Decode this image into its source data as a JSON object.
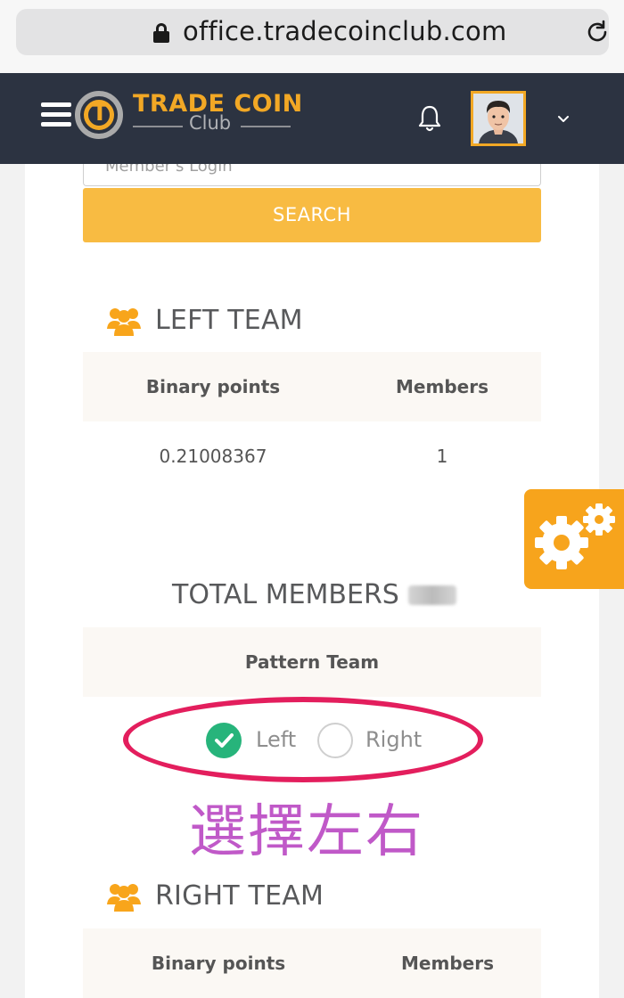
{
  "browser": {
    "url": "office.tradecoinclub.com"
  },
  "header": {
    "brand_main": "TRADE COIN",
    "brand_sub": "Club",
    "logo_letter": "T"
  },
  "search": {
    "placeholder": "Member's Login",
    "button_label": "SEARCH"
  },
  "left_team": {
    "title": "LEFT TEAM",
    "columns": [
      "Binary points",
      "Members"
    ],
    "row": [
      "0.21008367",
      "1"
    ]
  },
  "total_members": {
    "label": "TOTAL MEMBERS"
  },
  "pattern": {
    "heading": "Pattern Team",
    "options": [
      {
        "label": "Left",
        "selected": true
      },
      {
        "label": "Right",
        "selected": false
      }
    ]
  },
  "annotation": {
    "text": "選擇左右",
    "color": "#c059c8",
    "circle_color": "#e31e5d"
  },
  "right_team": {
    "title": "RIGHT TEAM",
    "columns": [
      "Binary points",
      "Members"
    ]
  },
  "colors": {
    "accent": "#f8bb42",
    "header_bg": "#2c3341",
    "radio_selected": "#27b47b",
    "settings_tab": "#f7a41c"
  },
  "icons": [
    "lock-icon",
    "reload-icon",
    "hamburger-icon",
    "bell-icon",
    "chevron-down-icon",
    "team-icon",
    "gear-icon",
    "check-icon"
  ]
}
